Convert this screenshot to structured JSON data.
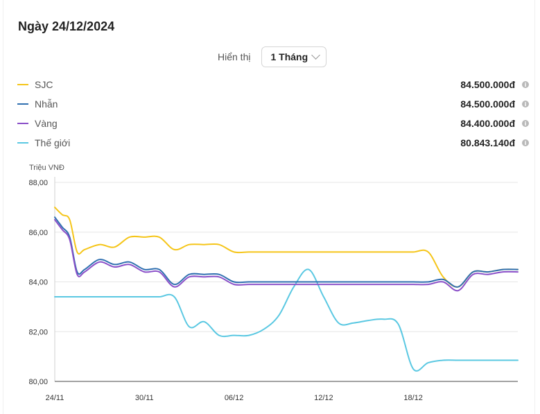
{
  "header": {
    "title": "Ngày 24/12/2024"
  },
  "display": {
    "label": "Hiển thị",
    "selected": "1 Tháng"
  },
  "legend": [
    {
      "name": "SJC",
      "price": "84.500.000đ",
      "color": "#f5c518",
      "icon": "info-icon"
    },
    {
      "name": "Nhẫn",
      "price": "84.500.000đ",
      "color": "#2f6fb0",
      "icon": "info-icon"
    },
    {
      "name": "Vàng",
      "price": "84.400.000đ",
      "color": "#8a4fc8",
      "icon": "info-icon"
    },
    {
      "name": "Thế giới",
      "price": "80.843.140đ",
      "color": "#5ac8e2",
      "icon": "info-icon"
    }
  ],
  "chart_data": {
    "type": "line",
    "ylabel": "Triệu VNĐ",
    "ylim": [
      80,
      88
    ],
    "yticks": [
      "88,00",
      "86,00",
      "84,00",
      "82,00",
      "80,00"
    ],
    "xticks": [
      {
        "label": "24/11",
        "day": 0
      },
      {
        "label": "30/11",
        "day": 6
      },
      {
        "label": "06/12",
        "day": 12
      },
      {
        "label": "12/12",
        "day": 18
      },
      {
        "label": "18/12",
        "day": 24
      }
    ],
    "grid": true,
    "series": [
      {
        "name": "SJC",
        "color": "#f5c518",
        "points": [
          [
            0,
            87.0
          ],
          [
            0.5,
            86.7
          ],
          [
            1,
            86.5
          ],
          [
            1.5,
            85.2
          ],
          [
            2,
            85.3
          ],
          [
            3,
            85.5
          ],
          [
            4,
            85.4
          ],
          [
            5,
            85.8
          ],
          [
            6,
            85.8
          ],
          [
            7,
            85.8
          ],
          [
            8,
            85.3
          ],
          [
            9,
            85.5
          ],
          [
            10,
            85.5
          ],
          [
            11,
            85.5
          ],
          [
            12,
            85.2
          ],
          [
            13,
            85.2
          ],
          [
            14,
            85.2
          ],
          [
            15,
            85.2
          ],
          [
            16,
            85.2
          ],
          [
            17,
            85.2
          ],
          [
            18,
            85.2
          ],
          [
            19,
            85.2
          ],
          [
            20,
            85.2
          ],
          [
            21,
            85.2
          ],
          [
            22,
            85.2
          ],
          [
            23,
            85.2
          ],
          [
            24,
            85.2
          ],
          [
            25,
            85.2
          ],
          [
            26,
            84.2
          ],
          [
            27,
            83.8
          ],
          [
            28,
            84.4
          ],
          [
            29,
            84.4
          ],
          [
            30,
            84.5
          ],
          [
            31,
            84.5
          ]
        ]
      },
      {
        "name": "Nhẫn",
        "color": "#2f6fb0",
        "points": [
          [
            0,
            86.6
          ],
          [
            0.5,
            86.2
          ],
          [
            1,
            85.8
          ],
          [
            1.5,
            84.4
          ],
          [
            2,
            84.5
          ],
          [
            3,
            84.9
          ],
          [
            4,
            84.7
          ],
          [
            5,
            84.8
          ],
          [
            6,
            84.5
          ],
          [
            7,
            84.5
          ],
          [
            8,
            83.9
          ],
          [
            9,
            84.3
          ],
          [
            10,
            84.3
          ],
          [
            11,
            84.3
          ],
          [
            12,
            84.0
          ],
          [
            13,
            84.0
          ],
          [
            14,
            84.0
          ],
          [
            15,
            84.0
          ],
          [
            16,
            84.0
          ],
          [
            17,
            84.0
          ],
          [
            18,
            84.0
          ],
          [
            19,
            84.0
          ],
          [
            20,
            84.0
          ],
          [
            21,
            84.0
          ],
          [
            22,
            84.0
          ],
          [
            23,
            84.0
          ],
          [
            24,
            84.0
          ],
          [
            25,
            84.0
          ],
          [
            26,
            84.1
          ],
          [
            27,
            83.8
          ],
          [
            28,
            84.4
          ],
          [
            29,
            84.4
          ],
          [
            30,
            84.5
          ],
          [
            31,
            84.5
          ]
        ]
      },
      {
        "name": "Vàng",
        "color": "#8a4fc8",
        "points": [
          [
            0,
            86.5
          ],
          [
            0.5,
            86.1
          ],
          [
            1,
            85.7
          ],
          [
            1.5,
            84.3
          ],
          [
            2,
            84.4
          ],
          [
            3,
            84.8
          ],
          [
            4,
            84.6
          ],
          [
            5,
            84.7
          ],
          [
            6,
            84.4
          ],
          [
            7,
            84.4
          ],
          [
            8,
            83.8
          ],
          [
            9,
            84.2
          ],
          [
            10,
            84.2
          ],
          [
            11,
            84.2
          ],
          [
            12,
            83.9
          ],
          [
            13,
            83.9
          ],
          [
            14,
            83.9
          ],
          [
            15,
            83.9
          ],
          [
            16,
            83.9
          ],
          [
            17,
            83.9
          ],
          [
            18,
            83.9
          ],
          [
            19,
            83.9
          ],
          [
            20,
            83.9
          ],
          [
            21,
            83.9
          ],
          [
            22,
            83.9
          ],
          [
            23,
            83.9
          ],
          [
            24,
            83.9
          ],
          [
            25,
            83.9
          ],
          [
            26,
            84.0
          ],
          [
            27,
            83.65
          ],
          [
            28,
            84.3
          ],
          [
            29,
            84.3
          ],
          [
            30,
            84.4
          ],
          [
            31,
            84.4
          ]
        ]
      },
      {
        "name": "Thế giới",
        "color": "#5ac8e2",
        "points": [
          [
            0,
            83.4
          ],
          [
            1,
            83.4
          ],
          [
            2,
            83.4
          ],
          [
            3,
            83.4
          ],
          [
            4,
            83.4
          ],
          [
            5,
            83.4
          ],
          [
            6,
            83.4
          ],
          [
            7,
            83.4
          ],
          [
            8,
            83.4
          ],
          [
            9,
            82.2
          ],
          [
            10,
            82.4
          ],
          [
            11,
            81.85
          ],
          [
            12,
            81.85
          ],
          [
            13,
            81.85
          ],
          [
            14,
            82.1
          ],
          [
            15,
            82.65
          ],
          [
            16,
            83.8
          ],
          [
            17,
            84.5
          ],
          [
            18,
            83.4
          ],
          [
            19,
            82.35
          ],
          [
            20,
            82.35
          ],
          [
            21,
            82.45
          ],
          [
            22,
            82.5
          ],
          [
            23,
            82.3
          ],
          [
            24,
            80.5
          ],
          [
            25,
            80.75
          ],
          [
            26,
            80.85
          ],
          [
            27,
            80.85
          ],
          [
            28,
            80.85
          ],
          [
            29,
            80.85
          ],
          [
            30,
            80.85
          ],
          [
            31,
            80.85
          ]
        ]
      }
    ]
  }
}
